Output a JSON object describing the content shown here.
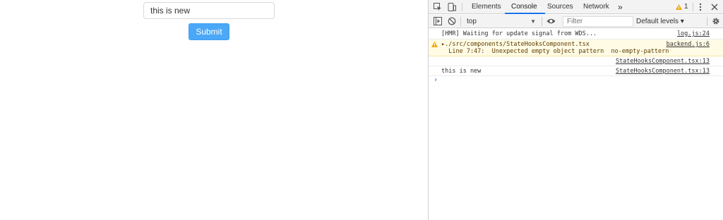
{
  "app": {
    "input_value": "this is new",
    "submit_label": "Submit"
  },
  "devtools": {
    "tabs": [
      "Elements",
      "Console",
      "Sources",
      "Network"
    ],
    "active_tab": "Console",
    "more_tabs_glyph": "»",
    "warning_count": "1",
    "toolbar": {
      "context": "top",
      "filter_placeholder": "Filter",
      "levels": "Default levels ▾"
    },
    "console": [
      {
        "type": "log",
        "message": "[HMR] Waiting for update signal from WDS...",
        "source": "log.js:24"
      },
      {
        "type": "warn",
        "message": "▸./src/components/StateHooksComponent.tsx",
        "message2": "  Line 7:47:  Unexpected empty object pattern  no-empty-pattern",
        "source": "backend.js:6"
      },
      {
        "type": "log",
        "message": "",
        "source": "StateHooksComponent.tsx:13"
      },
      {
        "type": "log",
        "message": "this is new",
        "source": "StateHooksComponent.tsx:13"
      }
    ],
    "prompt_glyph": "›"
  },
  "icons": {
    "inspect": "inspect-element-icon",
    "device": "device-toolbar-icon",
    "warning": "warning-icon",
    "kebab": "kebab-menu-icon",
    "close": "close-icon",
    "sidebar": "console-sidebar-icon",
    "clear": "clear-console-icon",
    "eye": "live-expression-icon",
    "settings": "gear-icon"
  },
  "colors": {
    "accent": "#1a73e8",
    "submit_bg": "#4aa8f7",
    "warning_bg": "#fffbe5",
    "warning_icon": "#f2a600"
  }
}
